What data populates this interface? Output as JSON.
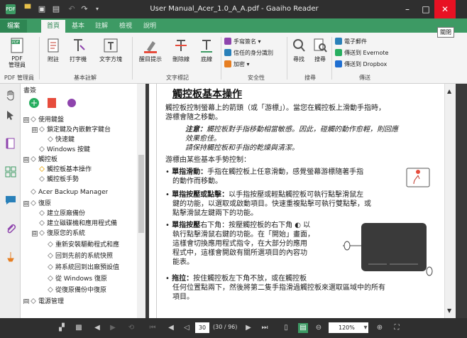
{
  "window": {
    "title": "User Manual_Acer_1.0_A_A.pdf - Gaaiho Reader"
  },
  "tabs": [
    {
      "label": "檔案"
    },
    {
      "label": "首頁"
    },
    {
      "label": "基本"
    },
    {
      "label": "註解"
    },
    {
      "label": "檢視"
    },
    {
      "label": "說明"
    }
  ],
  "tooltip": "關閉",
  "ribbon": {
    "pdf_manager": "PDF\n管理員",
    "annotate": "附註",
    "typewriter": "打字機",
    "textbox": "文字方塊",
    "highlight": "醒目提示",
    "strikeout": "刪除線",
    "underline": "底線",
    "handwriting_sign": "手寫簽名",
    "trusted_id": "信任的身分識別",
    "encrypt": "加密",
    "find": "尋找",
    "search": "搜尋",
    "email": "電子郵件",
    "send_evernote": "傳送到 Evernote",
    "send_dropbox": "傳送到 Dropbox",
    "groups": {
      "pdf_manager": "PDF 管理員",
      "basic": "基本註解",
      "text_markup": "文字標記",
      "security": "安全性",
      "search": "搜尋",
      "send": "傳送"
    }
  },
  "panel": {
    "title": "書簽",
    "tree": [
      {
        "label": "使用鍵盤",
        "toggle": "⊟"
      },
      {
        "label": "鎖定鍵及內嵌數字鍵台",
        "toggle": "⊟"
      },
      {
        "label": "快速鍵",
        "toggle": ""
      },
      {
        "label": "Windows 按鍵",
        "toggle": ""
      },
      {
        "label": "觸控板",
        "toggle": "⊟"
      },
      {
        "label": "觸控板基本操作",
        "toggle": ""
      },
      {
        "label": "觸控板手勢",
        "toggle": ""
      },
      {
        "label": "Acer Backup Manager",
        "toggle": ""
      },
      {
        "label": "復原",
        "toggle": "⊟"
      },
      {
        "label": "建立原廠備份",
        "toggle": ""
      },
      {
        "label": "建立磁碟機和應用程式備",
        "toggle": ""
      },
      {
        "label": "復原您的系統",
        "toggle": "⊟"
      },
      {
        "label": "重新安裝驅動程式和應",
        "toggle": ""
      },
      {
        "label": "回到先前的系統快照",
        "toggle": ""
      },
      {
        "label": "將系統回到出廠預設值",
        "toggle": ""
      },
      {
        "label": "從 Windows 復原",
        "toggle": ""
      },
      {
        "label": "從復原備份中復原",
        "toggle": ""
      },
      {
        "label": "電源管理",
        "toggle": "⊟"
      }
    ]
  },
  "document": {
    "heading": "觸控板基本操作",
    "intro": [
      "觸控板控制螢幕上的箭頭（或「游標」）。當您在觸控板上滑動手指時，",
      "游標會隨之移動。"
    ],
    "note_label": "注意：",
    "note_1": "觸控板對手指移動相當敏感。因此，碰觸的動作愈輕，則回應",
    "note_2": "效果愈佳。",
    "note_3": "請保持觸控板和手指的乾燥與清潔。",
    "gestures_intro": "游標由某些基本手勢控制：",
    "b1_title": "單指滑動：",
    "b1_lines": [
      "手指在觸控板上任意滑動，感覺螢幕游標隨著手指",
      "的動作而移動。"
    ],
    "b2_title": "單指按壓或點擊：",
    "b2_lines": [
      "以手指按壓或輕點觸控板可執行點擊滑鼠左",
      "鍵的功能，以選取或啟動項目。快速重複點擊可執行雙點擊，或",
      "點擊滑鼠左鍵兩下的功能。"
    ],
    "b3_title": "單指按壓",
    "b3_lines": [
      "右下角：按壓觸控板的右下角",
      "以",
      "執行點擊滑鼠右鍵的功能。在「開始」畫面，",
      "這樣會切換應用程式指令，在大部分的應用",
      "程式中，這樣會開啟有關所選項目的內容功",
      "能表。"
    ],
    "b4_title": "拖拉：",
    "b4_lines": [
      "按住觸控板左下角不放，或在觸控板",
      "任何位置點兩下，然後將第二隻手指滑過觸控板來選取區域中的所有",
      "項目。"
    ]
  },
  "nav": {
    "page": "30",
    "count": "(30 / 96)",
    "zoom": "120%"
  }
}
